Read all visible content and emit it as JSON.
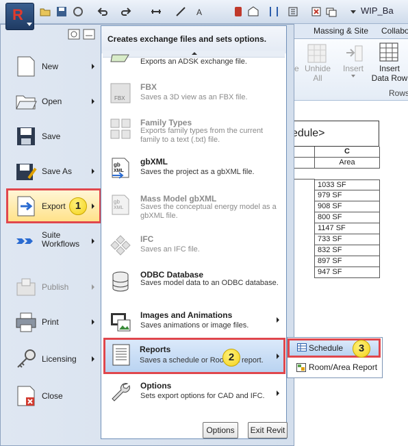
{
  "window": {
    "title": "WIP_Ba"
  },
  "ribbon": {
    "tabs": [
      "Massing & Site",
      "Collabo"
    ],
    "buttons": [
      {
        "label": "e"
      },
      {
        "label": "Unhide All"
      },
      {
        "label": "Insert"
      },
      {
        "label": "Insert Data Row"
      }
    ],
    "panel_label": "Rows"
  },
  "schedule": {
    "title": "edule>",
    "col_letter": "C",
    "col_header": "Area",
    "values": [
      "1033 SF",
      "979 SF",
      "908 SF",
      "800 SF",
      "1147 SF",
      "733 SF",
      "832 SF",
      "897 SF",
      "947 SF"
    ]
  },
  "app_menu": {
    "left_items": [
      {
        "label": "New",
        "icon": "new-document-icon",
        "has_arrow": true,
        "enabled": true
      },
      {
        "label": "Open",
        "icon": "folder-open-icon",
        "has_arrow": true,
        "enabled": true
      },
      {
        "label": "Save",
        "icon": "floppy-disk-icon",
        "has_arrow": false,
        "enabled": true
      },
      {
        "label": "Save As",
        "icon": "save-as-icon",
        "has_arrow": true,
        "enabled": true
      },
      {
        "label": "Export",
        "icon": "export-arrow-icon",
        "has_arrow": true,
        "enabled": true
      },
      {
        "label": "Suite Workflows",
        "icon": "suite-workflows-icon",
        "has_arrow": true,
        "enabled": true
      },
      {
        "label": "Publish",
        "icon": "publish-icon",
        "has_arrow": true,
        "enabled": false
      },
      {
        "label": "Print",
        "icon": "printer-icon",
        "has_arrow": true,
        "enabled": true
      },
      {
        "label": "Licensing",
        "icon": "key-icon",
        "has_arrow": true,
        "enabled": true
      },
      {
        "label": "Close",
        "icon": "close-document-icon",
        "has_arrow": false,
        "enabled": true
      }
    ],
    "submenu": {
      "heading": "Creates exchange files and sets options.",
      "items": [
        {
          "title": "",
          "desc": "Exports an ADSK exchange file.",
          "icon": "adsk-icon",
          "enabled": true
        },
        {
          "title": "FBX",
          "desc": "Saves a 3D view as an FBX file.",
          "icon": "fbx-icon",
          "enabled": false
        },
        {
          "title": "Family Types",
          "desc": "Exports family types from the current family to a text (.txt) file.",
          "icon": "family-types-icon",
          "enabled": false
        },
        {
          "title": "gbXML",
          "desc": "Saves the project as a gbXML file.",
          "icon": "gbxml-icon",
          "enabled": true
        },
        {
          "title": "Mass Model gbXML",
          "desc": "Saves the conceptual energy model as a gbXML file.",
          "icon": "mass-gbxml-icon",
          "enabled": false
        },
        {
          "title": "IFC",
          "desc": "Saves an IFC file.",
          "icon": "ifc-icon",
          "enabled": false
        },
        {
          "title": "ODBC Database",
          "desc": "Saves model data to an ODBC database.",
          "icon": "database-icon",
          "enabled": true
        },
        {
          "title": "Images and Animations",
          "desc": "Saves animations or image files.",
          "icon": "film-icon",
          "enabled": true
        },
        {
          "title": "Reports",
          "desc": "Saves a schedule or Roo",
          "desc_end": "rea report.",
          "icon": "report-icon",
          "enabled": true
        },
        {
          "title": "Options",
          "desc": "Sets export options for CAD and IFC.",
          "icon": "wrench-icon",
          "enabled": true
        }
      ],
      "footer": {
        "options_label": "Options",
        "exit_label": "Exit Revit"
      }
    },
    "flyout": [
      {
        "label": "Schedule",
        "icon": "schedule-icon"
      },
      {
        "label": "Room/Area Report",
        "icon": "room-report-icon"
      }
    ]
  },
  "callouts": [
    "1",
    "2",
    "3"
  ],
  "colors": {
    "highlight_border": "#e0464c",
    "callout": "#f4d11c",
    "accent": "#1f3b63"
  }
}
